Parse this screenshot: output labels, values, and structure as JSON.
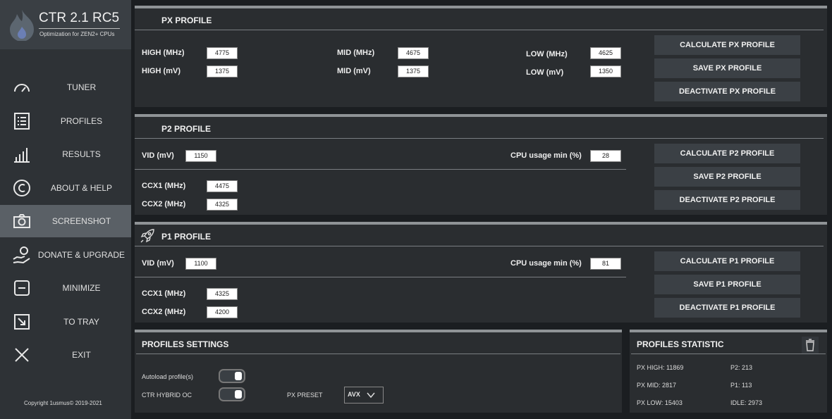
{
  "app": {
    "title": "CTR 2.1 RC5",
    "subtitle": "Optimization for ZEN2+ CPUs",
    "copyright": "Copyright 1usmus© 2019-2021"
  },
  "nav": [
    {
      "label": "TUNER",
      "icon": "speedometer-icon"
    },
    {
      "label": "PROFILES",
      "icon": "list-icon"
    },
    {
      "label": "RESULTS",
      "icon": "bar-chart-icon"
    },
    {
      "label": "ABOUT & HELP",
      "icon": "copyright-icon"
    },
    {
      "label": "SCREENSHOT",
      "icon": "camera-icon",
      "active": true
    },
    {
      "label": "DONATE & UPGRADE",
      "icon": "donate-icon"
    },
    {
      "label": "MINIMIZE",
      "icon": "minimize-icon"
    },
    {
      "label": "TO TRAY",
      "icon": "tray-icon"
    },
    {
      "label": "EXIT",
      "icon": "close-icon"
    }
  ],
  "px": {
    "title": "PX PROFILE",
    "high_mhz_label": "HIGH (MHz)",
    "high_mhz": "4775",
    "high_mv_label": "HIGH  (mV)",
    "high_mv": "1375",
    "mid_mhz_label": "MID (MHz)",
    "mid_mhz": "4675",
    "mid_mv_label": "MID (mV)",
    "mid_mv": "1375",
    "low_mhz_label": "LOW (MHz)",
    "low_mhz": "4625",
    "low_mv_label": "LOW (mV)",
    "low_mv": "1350",
    "calc": "CALCULATE PX PROFILE",
    "save": "SAVE PX PROFILE",
    "deact": "DEACTIVATE PX PROFILE"
  },
  "p2": {
    "title": "P2 PROFILE",
    "vid_label": "VID (mV)",
    "vid": "1150",
    "cpu_label": "CPU usage min (%)",
    "cpu": "28",
    "ccx1_label": "CCX1 (MHz)",
    "ccx1": "4475",
    "ccx2_label": "CCX2 (MHz)",
    "ccx2": "4325",
    "calc": "CALCULATE P2 PROFILE",
    "save": "SAVE P2 PROFILE",
    "deact": "DEACTIVATE P2 PROFILE"
  },
  "p1": {
    "title": "P1 PROFILE",
    "vid_label": "VID (mV)",
    "vid": "1100",
    "cpu_label": "CPU usage min (%)",
    "cpu": "81",
    "ccx1_label": "CCX1 (MHz)",
    "ccx1": "4325",
    "ccx2_label": "CCX2 (MHz)",
    "ccx2": "4200",
    "calc": "CALCULATE P1 PROFILE",
    "save": "SAVE P1 PROFILE",
    "deact": "DEACTIVATE P1 PROFILE"
  },
  "settings": {
    "title": "PROFILES SETTINGS",
    "autoload": "Autoload profile(s)",
    "autoload_on": true,
    "hybrid": "CTR HYBRID OC",
    "hybrid_on": true,
    "preset_label": "PX PRESET",
    "preset": "AVX"
  },
  "stats": {
    "title": "PROFILES STATISTIC",
    "px_high": "PX HIGH: 11869",
    "px_mid": "PX MID: 2817",
    "px_low": "PX LOW: 15403",
    "p2": "P2: 213",
    "p1": "P1: 113",
    "idle": "IDLE: 2973"
  }
}
